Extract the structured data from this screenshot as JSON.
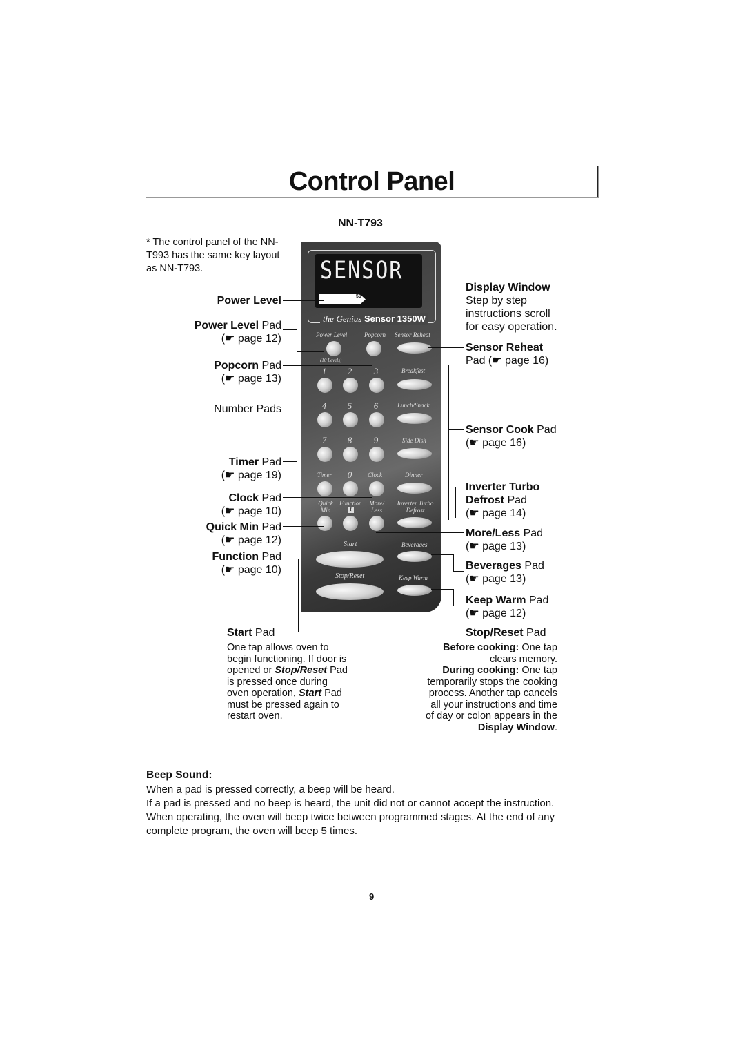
{
  "header": {
    "title": "Control Panel",
    "model": "NN-T793"
  },
  "note": "* The control panel of the NN-T993 has the same key layout as NN-T793.",
  "panel": {
    "display_text": "SENSOR",
    "power_bar_text": "50 %",
    "power_level_fraction": 0.5,
    "brand_the": "the",
    "brand_genius": "Genius",
    "brand_sensor": "Sensor 1350W",
    "pads": {
      "power_level": "Power Level",
      "ten_levels": "(10 Levels)",
      "popcorn": "Popcorn",
      "sensor_reheat": "Sensor Reheat",
      "breakfast": "Breakfast",
      "lunch": "Lunch/Snack",
      "side_dish": "Side Dish",
      "dinner": "Dinner",
      "timer": "Timer",
      "clock": "Clock",
      "quick_min": "Quick Min",
      "function": "Function",
      "function_icon": "f",
      "more_less": "More/ Less",
      "inverter": "Inverter Turbo Defrost",
      "start": "Start",
      "beverages": "Beverages",
      "stop_reset": "Stop/Reset",
      "keep_warm": "Keep Warm"
    },
    "numbers": [
      "1",
      "2",
      "3",
      "4",
      "5",
      "6",
      "7",
      "8",
      "9",
      "0"
    ]
  },
  "callouts_left": {
    "power_level": "Power Level",
    "power_level_pad_b": "Power Level",
    "power_level_pad_n": " Pad",
    "power_level_page": "(☛ page 12)",
    "popcorn_b": "Popcorn",
    "popcorn_n": " Pad",
    "popcorn_page": "(☛ page 13)",
    "number_pads": "Number Pads",
    "timer_b": "Timer",
    "timer_n": " Pad",
    "timer_page": "(☛ page 19)",
    "clock_b": "Clock",
    "clock_n": " Pad",
    "clock_page": "(☛ page 10)",
    "quick_b": "Quick Min",
    "quick_n": " Pad",
    "quick_page": "(☛ page 12)",
    "function_b": "Function",
    "function_n": " Pad",
    "function_page": "(☛ page 10)"
  },
  "callouts_right": {
    "display_b": "Display Window",
    "display_desc": [
      "Step by step",
      "instructions scroll",
      "for easy operation."
    ],
    "reheat_b": "Sensor Reheat",
    "reheat_page": "Pad (☛ page 16)",
    "cook_b": "Sensor Cook",
    "cook_n": " Pad",
    "cook_page": "(☛ page 16)",
    "inverter_b1": "Inverter Turbo",
    "inverter_b2": "Defrost",
    "inverter_n": " Pad",
    "inverter_page": "(☛ page 14)",
    "more_b": "More/Less",
    "more_n": " Pad",
    "more_page": "(☛ page 13)",
    "bev_b": "Beverages",
    "bev_n": " Pad",
    "bev_page": "(☛ page 13)",
    "warm_b": "Keep Warm",
    "warm_n": " Pad",
    "warm_page": "(☛ page 12)"
  },
  "start_pad": {
    "title_b": "Start",
    "title_n": " Pad",
    "lines": [
      "One tap allows oven to",
      "begin functioning. If door is"
    ],
    "line3_a": "opened or ",
    "line3_b": "Stop/Reset",
    "line3_c": " Pad",
    "line4": "is pressed once during",
    "line5_a": "oven operation, ",
    "line5_b": "Start",
    "line5_c": " Pad",
    "lines_end": [
      "must be pressed again to",
      "restart oven."
    ]
  },
  "stop_pad": {
    "title_b": "Stop/Reset",
    "title_n": " Pad",
    "before_b": "Before cooking:",
    "before_n": " One tap",
    "before_2": "clears memory.",
    "during_b": "During cooking:",
    "during_n": " One tap",
    "lines": [
      "temporarily stops the cooking",
      "process. Another tap cancels",
      "all your instructions and time",
      "of day or colon appears in the"
    ],
    "end_b": "Display Window",
    "end_n": "."
  },
  "beep": {
    "heading": "Beep Sound:",
    "lines": [
      "When a pad is pressed correctly, a beep will be heard.",
      "If a pad is pressed and no beep is heard, the unit did not or cannot accept the instruction.",
      "When operating, the oven will beep twice between programmed stages. At the end of any",
      "complete program, the oven will beep 5 times."
    ]
  },
  "page_number": "9"
}
